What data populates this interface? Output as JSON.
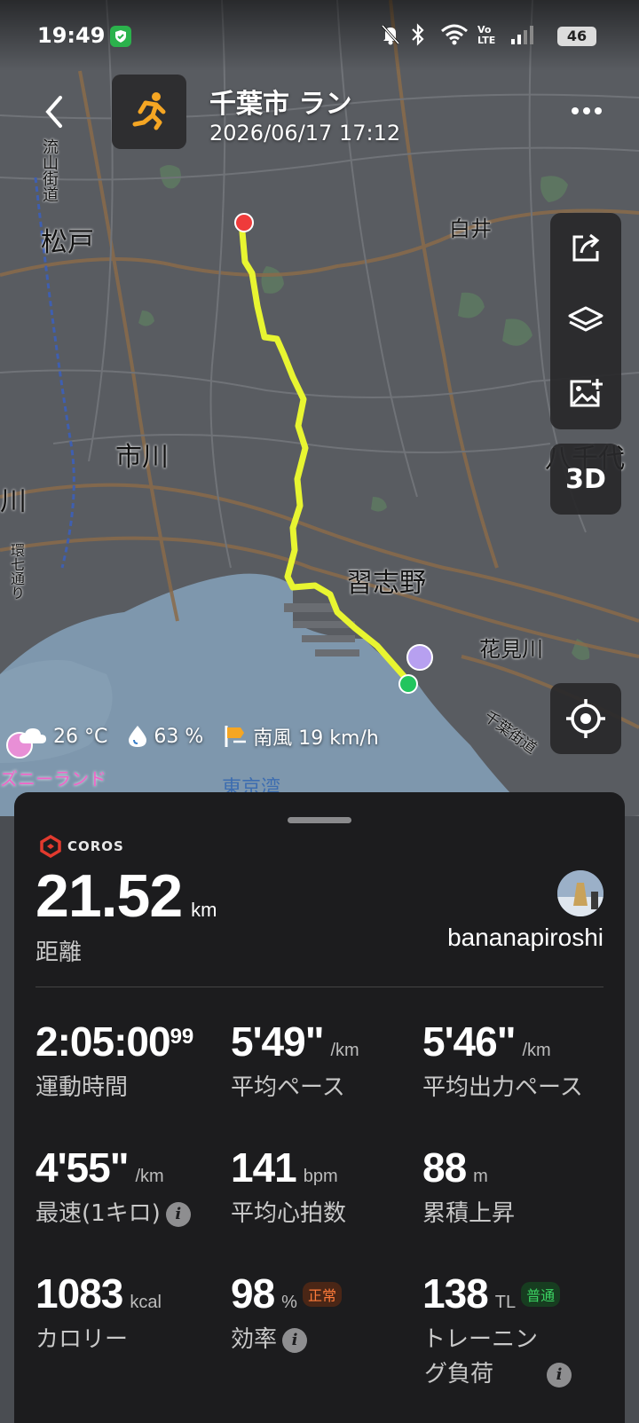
{
  "status_bar": {
    "time": "19:49",
    "battery": "46",
    "icons": [
      "shield-icon",
      "bell-off-icon",
      "bluetooth-icon",
      "wifi-icon",
      "volte-icon",
      "signal-icon",
      "battery-icon"
    ],
    "volte_label": "Vo\nLTE"
  },
  "header": {
    "title": "千葉市 ラン",
    "datetime": "2026/06/17 17:12",
    "activity_icon": "running-icon"
  },
  "map": {
    "labels": {
      "matsudo": "松戸",
      "shiroi": "白井",
      "ichikawa": "市川",
      "ichikawa_edge": "川",
      "narashino": "習志野",
      "yachiyo": "八千代",
      "hanamigawa": "花見川",
      "nagareyama": "流山街道",
      "kannana": "環七通り",
      "chiba_kaido": "千葉街道",
      "disneyland": "ズニーランド",
      "tokyo_bay": "東京湾",
      "chi_edge": "千"
    },
    "colors": {
      "route": "#e8f531",
      "start": "#22c55e",
      "end": "#ef3b3b",
      "water": "#7e97ad"
    }
  },
  "toolbar": {
    "share_icon": "share-icon",
    "layers_icon": "layers-icon",
    "add_photo_icon": "add-photo-icon",
    "mode_3d": "3D",
    "locate_icon": "locate-icon"
  },
  "weather": {
    "temp": "26 °C",
    "humidity": "63 %",
    "wind": "南風 19 km/h"
  },
  "panel": {
    "brand": "COROS",
    "distance": {
      "value": "21.52",
      "unit": "km",
      "label": "距離"
    },
    "username": "bananapiroshi",
    "stats": [
      {
        "value": "2:05:00",
        "sup": "99",
        "unit": "",
        "label": "運動時間"
      },
      {
        "value": "5'49\"",
        "unit": "/km",
        "label": "平均ペース"
      },
      {
        "value": "5'46\"",
        "unit": "/km",
        "label": "平均出力ペース"
      },
      {
        "value": "4'55\"",
        "unit": "/km",
        "label": "最速(1キロ)"
      },
      {
        "value": "141",
        "unit": "bpm",
        "label": "平均心拍数"
      },
      {
        "value": "88",
        "unit": "m",
        "label": "累積上昇"
      },
      {
        "value": "1083",
        "unit": "kcal",
        "label": "カロリー"
      },
      {
        "value": "98",
        "unit": "%",
        "label": "効率",
        "badge": "正常"
      },
      {
        "value": "138",
        "unit": "TL",
        "label": "トレーニン",
        "label2": "グ負荷",
        "badge": "普通"
      }
    ]
  }
}
